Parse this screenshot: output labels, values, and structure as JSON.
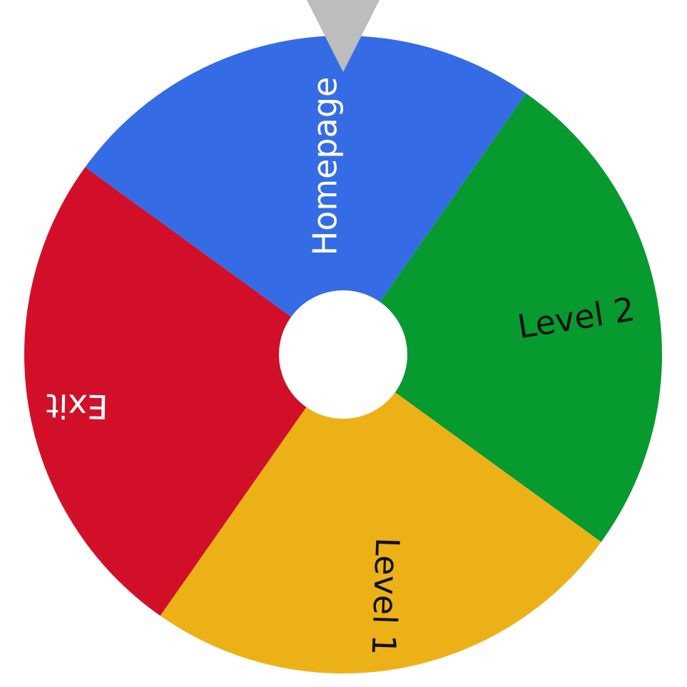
{
  "wheel": {
    "segments": [
      {
        "label": "Homepage",
        "color": "#356CE5",
        "text_color": "#ffffff"
      },
      {
        "label": "Level 2",
        "color": "#069A2F",
        "text_color": "#111111"
      },
      {
        "label": "Level 1",
        "color": "#EDB118",
        "text_color": "#111111"
      },
      {
        "label": "Exit",
        "color": "#D20F29",
        "text_color": "#ffffff"
      }
    ],
    "hub_color": "#ffffff",
    "pointer_color": "#BDBDBD",
    "pointer_icon": "triangle-down-pointer-icon"
  }
}
